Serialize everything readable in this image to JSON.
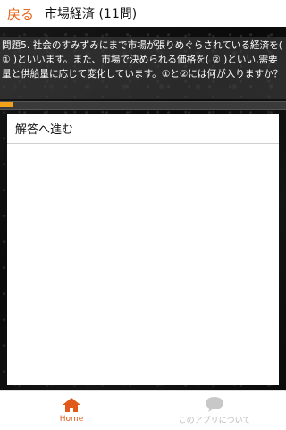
{
  "header": {
    "back_label": "戻る",
    "title": "市場経済 (11問)"
  },
  "question": {
    "text": "問題5. 社会のすみずみにまで市場が張りめぐらされている経済を( ① )といいます。また、市場で決められる価格を( ② )といい,需要量と供給量に応じて変化しています。①と②には何が入りますか？"
  },
  "progress": {
    "fraction": 0.045
  },
  "answer": {
    "button_label": "解答へ進む"
  },
  "bottom_nav": {
    "items": [
      {
        "label": "Home",
        "icon": "home-icon",
        "active": true
      },
      {
        "label": "このアプリについて",
        "icon": "speech-bubble-icon",
        "active": false
      }
    ]
  },
  "colors": {
    "accent": "#e8631a",
    "progress": "#f3a11a",
    "inactive": "#bdbdbd"
  }
}
